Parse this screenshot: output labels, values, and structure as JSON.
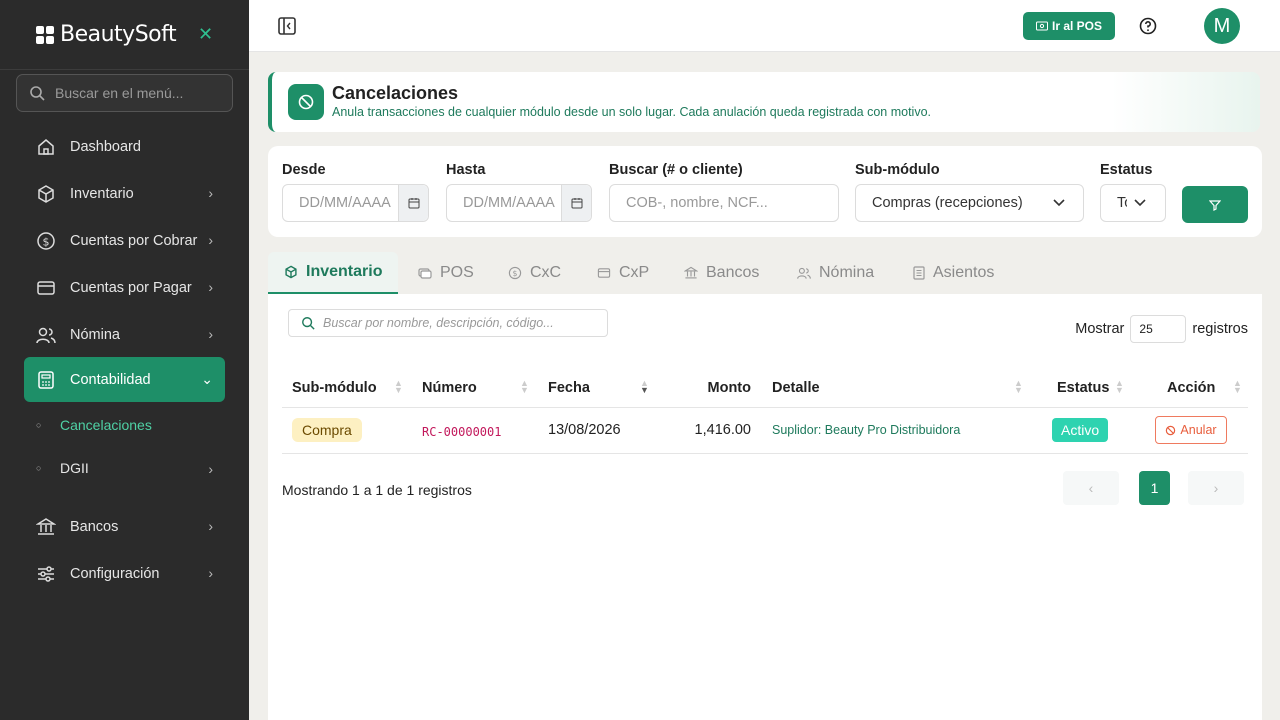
{
  "brand": {
    "name": "BeautySoft"
  },
  "sidebar": {
    "search_placeholder": "Buscar en el menú...",
    "items": [
      {
        "label": "Dashboard",
        "icon": "home-icon"
      },
      {
        "label": "Inventario",
        "icon": "box-icon"
      },
      {
        "label": "Cuentas por Cobrar",
        "icon": "dollar-icon"
      },
      {
        "label": "Cuentas por Pagar",
        "icon": "card-icon"
      },
      {
        "label": "Nómina",
        "icon": "users-icon"
      },
      {
        "label": "Contabilidad",
        "icon": "calculator-icon"
      },
      {
        "label": "Bancos",
        "icon": "bank-icon"
      },
      {
        "label": "Configuración",
        "icon": "sliders-icon"
      }
    ],
    "subitems": [
      {
        "label": "Cancelaciones"
      },
      {
        "label": "DGII"
      }
    ]
  },
  "topbar": {
    "pos_label": "Ir al POS",
    "avatar_initial": "M"
  },
  "header": {
    "title": "Cancelaciones",
    "subtitle": "Anula transacciones de cualquier módulo desde un solo lugar. Cada anulación queda registrada con motivo."
  },
  "filters": {
    "desde_label": "Desde",
    "desde_placeholder": "DD/MM/AAAA",
    "hasta_label": "Hasta",
    "hasta_placeholder": "DD/MM/AAAA",
    "buscar_label": "Buscar (# o cliente)",
    "buscar_placeholder": "COB-, nombre, NCF...",
    "submodulo_label": "Sub-módulo",
    "submodulo_value": "Compras (recepciones)",
    "estatus_label": "Estatus",
    "estatus_value": "Todos"
  },
  "tabs": [
    {
      "label": "Inventario",
      "icon": "box-icon"
    },
    {
      "label": "POS",
      "icon": "cash-icon"
    },
    {
      "label": "CxC",
      "icon": "dollar-icon"
    },
    {
      "label": "CxP",
      "icon": "card-icon"
    },
    {
      "label": "Bancos",
      "icon": "bank-icon"
    },
    {
      "label": "Nómina",
      "icon": "users-icon"
    },
    {
      "label": "Asientos",
      "icon": "receipt-icon"
    }
  ],
  "table": {
    "search_placeholder": "Buscar por nombre, descripción, código...",
    "show_label": "Mostrar",
    "show_value": "25",
    "records_label": "registros",
    "columns": [
      "Sub-módulo",
      "Número",
      "Fecha",
      "Monto",
      "Detalle",
      "Estatus",
      "Acción"
    ],
    "rows": [
      {
        "submodulo": "Compra",
        "numero": "RC-00000001",
        "fecha": "13/08/2026",
        "monto": "1,416.00",
        "detalle": "Suplidor: Beauty Pro Distribuidora",
        "estatus": "Activo",
        "accion": "Anular"
      }
    ],
    "footer": "Mostrando 1 a 1 de 1 registros",
    "pager_prev": "‹",
    "pager_page": "1",
    "pager_next": "›"
  },
  "colors": {
    "accent": "#1e8f68",
    "sidebar_bg": "#2b2b2b",
    "danger": "#e85d3c"
  }
}
